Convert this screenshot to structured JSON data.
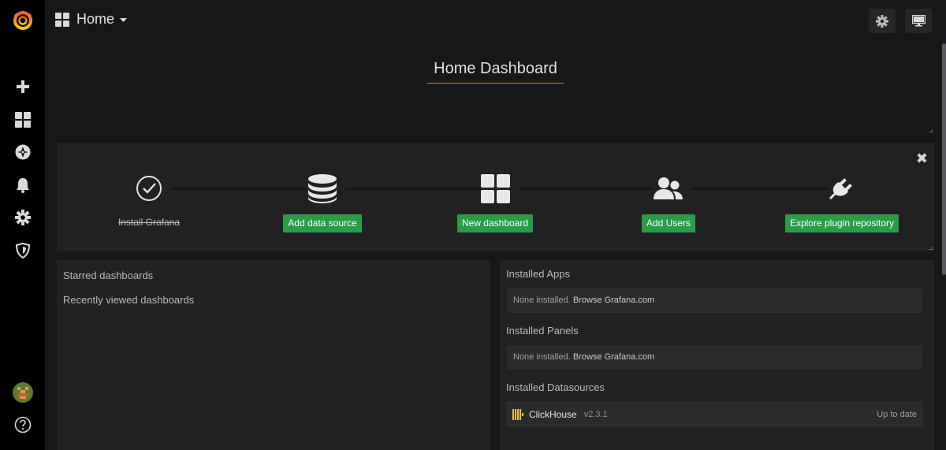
{
  "nav": {
    "title": "Home"
  },
  "sidebar": {
    "items": [
      {
        "icon": "plus-icon"
      },
      {
        "icon": "dashboards-icon"
      },
      {
        "icon": "compass-icon"
      },
      {
        "icon": "bell-icon"
      },
      {
        "icon": "gear-icon"
      },
      {
        "icon": "shield-icon"
      }
    ]
  },
  "welcome": {
    "title": "Home Dashboard"
  },
  "getting_started": {
    "steps": [
      {
        "label": "Install Grafana",
        "done": true,
        "icon": "check-circle-icon"
      },
      {
        "label": "Add data source",
        "done": false,
        "icon": "database-icon"
      },
      {
        "label": "New dashboard",
        "done": false,
        "icon": "dashboards-icon"
      },
      {
        "label": "Add Users",
        "done": false,
        "icon": "users-icon"
      },
      {
        "label": "Explore plugin repository",
        "done": false,
        "icon": "plug-icon"
      }
    ],
    "close": "✖"
  },
  "dashlist": {
    "starred": "Starred dashboards",
    "recent": "Recently viewed dashboards"
  },
  "plugins": {
    "apps_heading": "Installed Apps",
    "apps_empty": "None installed.",
    "apps_link": "Browse Grafana.com",
    "panels_heading": "Installed Panels",
    "panels_empty": "None installed.",
    "panels_link": "Browse Grafana.com",
    "datasources_heading": "Installed Datasources",
    "datasource": {
      "name": "ClickHouse",
      "version": "v2.3.1",
      "status": "Up to date"
    }
  },
  "colors": {
    "accent": "#eb7b18",
    "success": "#299c46",
    "background": "#161719",
    "panel": "#212124"
  }
}
